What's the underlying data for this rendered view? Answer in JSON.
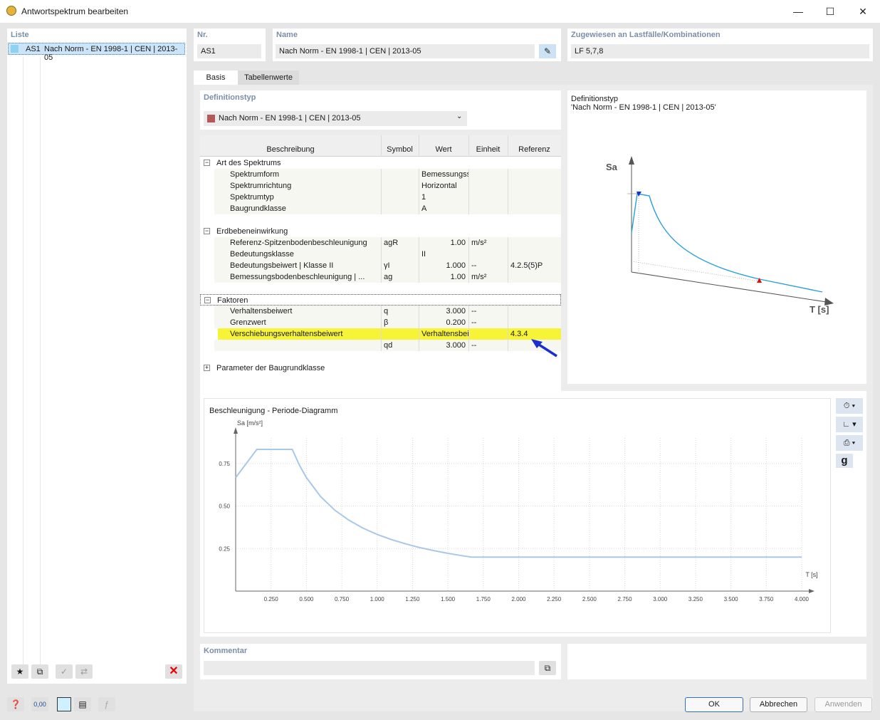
{
  "window": {
    "title": "Antwortspektrum bearbeiten"
  },
  "list": {
    "header": "Liste",
    "items": [
      {
        "id": "AS1",
        "name": "Nach Norm - EN 1998-1 | CEN | 2013-05"
      }
    ]
  },
  "nr": {
    "label": "Nr.",
    "value": "AS1"
  },
  "name": {
    "label": "Name",
    "value": "Nach Norm - EN 1998-1 | CEN | 2013-05"
  },
  "assigned": {
    "label": "Zugewiesen an Lastfälle/Kombinationen",
    "value": "LF 5,7,8"
  },
  "tabs": [
    {
      "label": "Basis"
    },
    {
      "label": "Tabellenwerte"
    }
  ],
  "deftype": {
    "label": "Definitionstyp",
    "value": "Nach Norm - EN 1998-1 | CEN | 2013-05",
    "color": "#b5585a"
  },
  "table": {
    "columns": [
      "Beschreibung",
      "Symbol",
      "Wert",
      "Einheit",
      "Referenz"
    ],
    "groups": [
      {
        "title": "Art des Spektrums",
        "rows": [
          {
            "desc": "Spektrumform",
            "sym": "",
            "val": "Bemessungsspektrum",
            "unit": "",
            "ref": ""
          },
          {
            "desc": "Spektrumrichtung",
            "sym": "",
            "val": "Horizontal",
            "unit": "",
            "ref": ""
          },
          {
            "desc": "Spektrumtyp",
            "sym": "",
            "val": "1",
            "unit": "",
            "ref": ""
          },
          {
            "desc": "Baugrundklasse",
            "sym": "",
            "val": "A",
            "unit": "",
            "ref": ""
          }
        ]
      },
      {
        "title": "Erdbebeneinwirkung",
        "rows": [
          {
            "desc": "Referenz-Spitzenbodenbeschleunigung",
            "sym": "agR",
            "val": "1.00",
            "unit": "m/s²",
            "ref": ""
          },
          {
            "desc": "Bedeutungsklasse",
            "sym": "",
            "val": "II",
            "unit": "",
            "ref": ""
          },
          {
            "desc": "Bedeutungsbeiwert | Klasse II",
            "sym": "γI",
            "val": "1.000",
            "unit": "--",
            "ref": "4.2.5(5)P"
          },
          {
            "desc": "Bemessungsbodenbeschleunigung | ...",
            "sym": "ag",
            "val": "1.00",
            "unit": "m/s²",
            "ref": ""
          }
        ]
      },
      {
        "title": "Faktoren",
        "rows": [
          {
            "desc": "Verhaltensbeiwert",
            "sym": "q",
            "val": "3.000",
            "unit": "--",
            "ref": ""
          },
          {
            "desc": "Grenzwert",
            "sym": "β",
            "val": "0.200",
            "unit": "--",
            "ref": ""
          },
          {
            "desc": "Verschiebungsverhaltensbeiwert",
            "sym": "",
            "val": "Verhaltensbeiwert q",
            "unit": "",
            "ref": "4.3.4"
          },
          {
            "desc": "",
            "sym": "qd",
            "val": "3.000",
            "unit": "--",
            "ref": ""
          }
        ]
      },
      {
        "title": "Parameter der Baugrundklasse",
        "rows": []
      }
    ]
  },
  "preview": {
    "title": "Definitionstyp",
    "subtitle": "'Nach Norm - EN 1998-1 | CEN | 2013-05'",
    "y_label": "Sa",
    "x_label": "T [s]"
  },
  "chart_data": {
    "type": "line",
    "title": "Beschleunigung - Periode-Diagramm",
    "ylabel": "Sa [m/s²]",
    "xlabel": "T [s]",
    "xlim": [
      0,
      4.0
    ],
    "ylim": [
      0,
      0.9
    ],
    "xticks": [
      "0.250",
      "0.500",
      "0.750",
      "1.000",
      "1.250",
      "1.500",
      "1.750",
      "2.000",
      "2.250",
      "2.500",
      "2.750",
      "3.000",
      "3.250",
      "3.500",
      "3.750",
      "4.000"
    ],
    "yticks": [
      "0.25",
      "0.50",
      "0.75"
    ],
    "grid": true,
    "series": [
      {
        "color": "#a8c8ea",
        "x": [
          0,
          0.15,
          0.4,
          0.45,
          0.5,
          0.6,
          0.7,
          0.8,
          0.9,
          1.0,
          1.1,
          1.2,
          1.3,
          1.4,
          1.5,
          1.6,
          1.667,
          2.0,
          2.5,
          3.0,
          3.5,
          4.0
        ],
        "y": [
          0.667,
          0.833,
          0.833,
          0.741,
          0.667,
          0.556,
          0.476,
          0.417,
          0.37,
          0.333,
          0.303,
          0.278,
          0.256,
          0.238,
          0.222,
          0.208,
          0.2,
          0.2,
          0.2,
          0.2,
          0.2,
          0.2
        ]
      }
    ]
  },
  "comment": {
    "label": "Kommentar",
    "value": ""
  },
  "buttons": {
    "ok": "OK",
    "cancel": "Abbrechen",
    "apply": "Anwenden"
  }
}
